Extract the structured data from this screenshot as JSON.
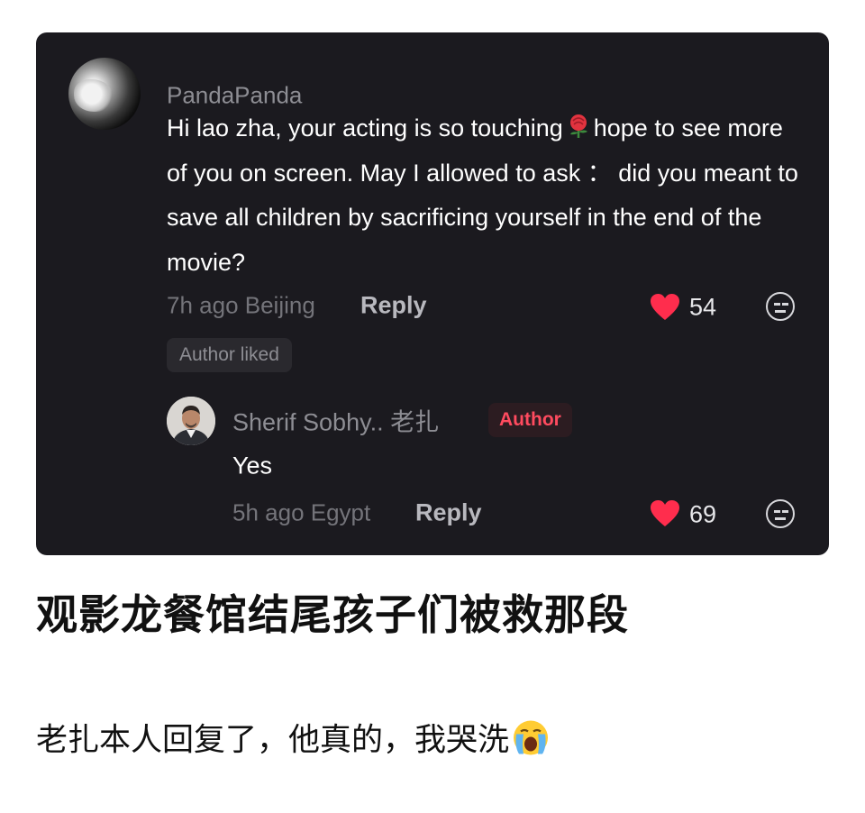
{
  "comment": {
    "username": "PandaPanda",
    "text_before_emoji": "Hi lao zha, your acting is so touching",
    "text_emoji": "rose-icon",
    "text_after_emoji": "hope to see more of you on screen. May I allowed to ask ： did you meant to save all children by sacrificing yourself in the end of the movie?",
    "meta": "7h ago Beijing",
    "reply_label": "Reply",
    "likes": "54",
    "author_liked_label": "Author liked"
  },
  "reply": {
    "username": "Sherif Sobhy.. 老扎",
    "author_badge": "Author",
    "text": "Yes",
    "meta": "5h ago Egypt",
    "reply_label": "Reply",
    "likes": "69"
  },
  "caption": {
    "headline": "观影龙餐馆结尾孩子们被救那段",
    "subline": "老扎本人回复了，他真的，我哭洗",
    "subline_emoji": "loudly-crying-face-icon"
  },
  "colors": {
    "card_background": "#1b1a1f",
    "heart": "#ff2d4d",
    "author_badge_text": "#ff4b5f"
  }
}
